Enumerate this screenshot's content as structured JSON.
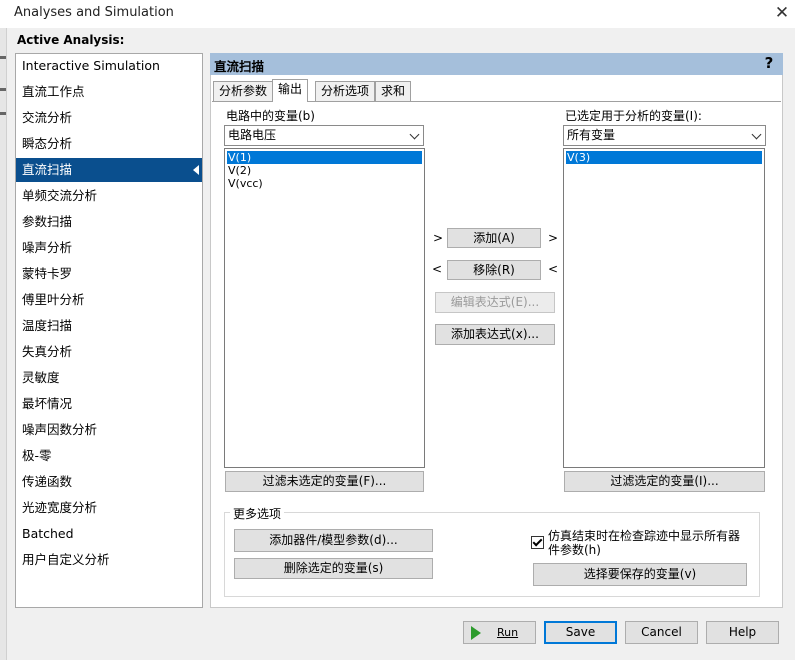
{
  "window": {
    "title": "Analyses and Simulation",
    "close_glyph": "✕"
  },
  "active_analysis_label": "Active Analysis:",
  "analyses": [
    "Interactive Simulation",
    "直流工作点",
    "交流分析",
    "瞬态分析",
    "直流扫描",
    "单频交流分析",
    "参数扫描",
    "噪声分析",
    "蒙特卡罗",
    "傅里叶分析",
    "温度扫描",
    "失真分析",
    "灵敏度",
    "最坏情况",
    "噪声因数分析",
    "极-零",
    "传递函数",
    "光迹宽度分析",
    "Batched",
    "用户自定义分析"
  ],
  "selected_analysis_index": 4,
  "section": {
    "title": "直流扫描",
    "help_glyph": "?"
  },
  "tabs": [
    {
      "label": "分析参数",
      "active": false
    },
    {
      "label": "输出",
      "active": true
    },
    {
      "label": "分析选项",
      "active": false
    },
    {
      "label": "求和",
      "active": false
    }
  ],
  "circuit_vars": {
    "label": "电路中的变量(b)",
    "filter_value": "电路电压",
    "items": [
      "V(1)",
      "V(2)",
      "V(vcc)"
    ],
    "selected_index": 0,
    "filter_button": "过滤未选定的变量(F)..."
  },
  "selected_vars": {
    "label": "已选定用于分析的变量(I):",
    "filter_value": "所有变量",
    "items": [
      "V(3)"
    ],
    "selected_index": 0,
    "filter_button": "过滤选定的变量(I)..."
  },
  "middle": {
    "add_label": "添加(A)",
    "remove_label": "移除(R)",
    "edit_expr_label": "编辑表达式(E)...",
    "add_expr_label": "添加表达式(x)...",
    "right_arrow": ">",
    "left_arrow": "<"
  },
  "more_options": {
    "title": "更多选项",
    "add_param_button": "添加器件/模型参数(d)...",
    "delete_var_button": "删除选定的变量(s)",
    "show_all_checkbox": {
      "line1": "仿真结束时在检查踪迹中显示所有器",
      "line2": "件参数(h)",
      "checked": true
    },
    "choose_save_button": "选择要保存的变量(v)"
  },
  "footer": {
    "run_label": "Run",
    "save_label": "Save",
    "cancel_label": "Cancel",
    "help_label": "Help"
  },
  "colors": {
    "selection": "#0a4f8e",
    "header": "#a5bfdb",
    "listbox_selection": "#0078d7",
    "run_icon": "#2d9b2d"
  }
}
